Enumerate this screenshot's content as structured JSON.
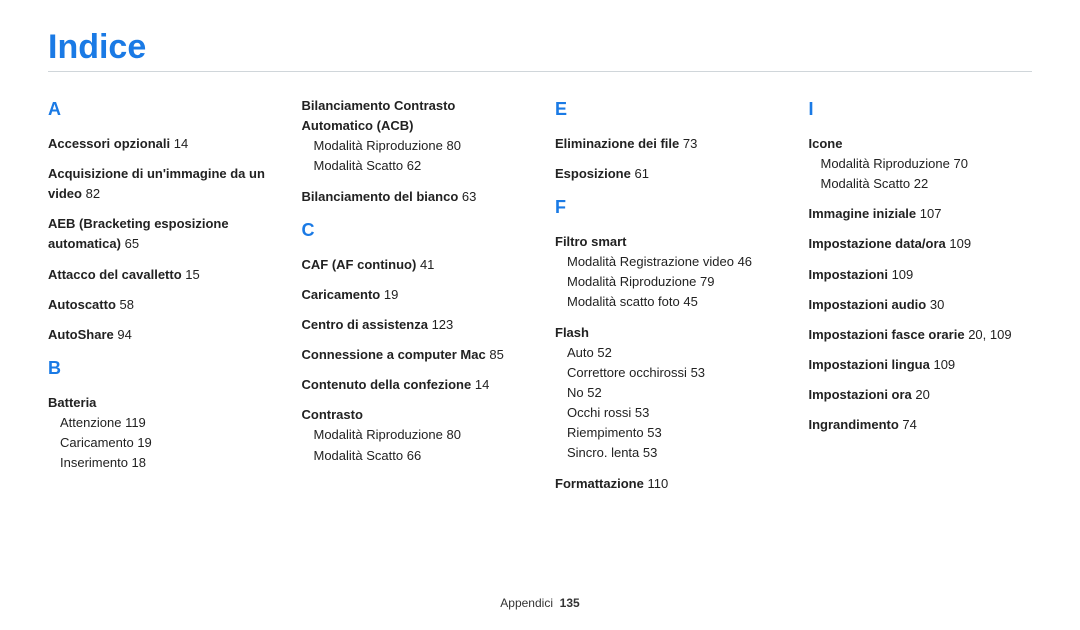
{
  "title": "Indice",
  "footer": {
    "section": "Appendici",
    "page": "135"
  },
  "columns": [
    {
      "sections": [
        {
          "letter": "A",
          "entries": [
            {
              "head": "Accessori opzionali",
              "page": "14"
            },
            {
              "head": "Acquisizione di un'immagine da un video",
              "page": "82"
            },
            {
              "head": "AEB (Bracketing esposizione automatica)",
              "page": "65"
            },
            {
              "head": "Attacco del cavalletto",
              "page": "15"
            },
            {
              "head": "Autoscatto",
              "page": "58"
            },
            {
              "head": "AutoShare",
              "page": "94"
            }
          ]
        },
        {
          "letter": "B",
          "entries": [
            {
              "head": "Batteria",
              "subs": [
                {
                  "label": "Attenzione",
                  "page": "119"
                },
                {
                  "label": "Caricamento",
                  "page": "19"
                },
                {
                  "label": "Inserimento",
                  "page": "18"
                }
              ]
            }
          ]
        }
      ]
    },
    {
      "sections": [
        {
          "letter": null,
          "entries": [
            {
              "head": "Bilanciamento Contrasto Automatico (ACB)",
              "subs": [
                {
                  "label": "Modalità Riproduzione",
                  "page": "80"
                },
                {
                  "label": "Modalità Scatto",
                  "page": "62"
                }
              ]
            },
            {
              "head": "Bilanciamento del bianco",
              "page": "63"
            }
          ]
        },
        {
          "letter": "C",
          "entries": [
            {
              "head": "CAF (AF continuo)",
              "page": "41"
            },
            {
              "head": "Caricamento",
              "page": "19"
            },
            {
              "head": "Centro di assistenza",
              "page": "123"
            },
            {
              "head": "Connessione a computer Mac",
              "page": "85"
            },
            {
              "head": "Contenuto della confezione",
              "page": "14"
            },
            {
              "head": "Contrasto",
              "subs": [
                {
                  "label": "Modalità Riproduzione",
                  "page": "80"
                },
                {
                  "label": "Modalità Scatto",
                  "page": "66"
                }
              ]
            }
          ]
        }
      ]
    },
    {
      "sections": [
        {
          "letter": "E",
          "entries": [
            {
              "head": "Eliminazione dei file",
              "page": "73"
            },
            {
              "head": "Esposizione",
              "page": "61"
            }
          ]
        },
        {
          "letter": "F",
          "entries": [
            {
              "head": "Filtro smart",
              "subs": [
                {
                  "label": "Modalità Registrazione video",
                  "page": "46"
                },
                {
                  "label": "Modalità Riproduzione",
                  "page": "79"
                },
                {
                  "label": "Modalità scatto foto",
                  "page": "45"
                }
              ]
            },
            {
              "head": "Flash",
              "subs": [
                {
                  "label": "Auto",
                  "page": "52"
                },
                {
                  "label": "Correttore occhirossi",
                  "page": "53"
                },
                {
                  "label": "No",
                  "page": "52"
                },
                {
                  "label": "Occhi rossi",
                  "page": "53"
                },
                {
                  "label": "Riempimento",
                  "page": "53"
                },
                {
                  "label": "Sincro. lenta",
                  "page": "53"
                }
              ]
            },
            {
              "head": "Formattazione",
              "page": "110"
            }
          ]
        }
      ]
    },
    {
      "sections": [
        {
          "letter": "I",
          "entries": [
            {
              "head": "Icone",
              "subs": [
                {
                  "label": "Modalità Riproduzione",
                  "page": "70"
                },
                {
                  "label": "Modalità Scatto",
                  "page": "22"
                }
              ]
            },
            {
              "head": "Immagine iniziale",
              "page": "107"
            },
            {
              "head": "Impostazione data/ora",
              "page": "109"
            },
            {
              "head": "Impostazioni",
              "page": "109"
            },
            {
              "head": "Impostazioni audio",
              "page": "30"
            },
            {
              "head": "Impostazioni fasce orarie",
              "page": "20, 109"
            },
            {
              "head": "Impostazioni lingua",
              "page": "109"
            },
            {
              "head": "Impostazioni ora",
              "page": "20"
            },
            {
              "head": "Ingrandimento",
              "page": "74"
            }
          ]
        }
      ]
    }
  ]
}
